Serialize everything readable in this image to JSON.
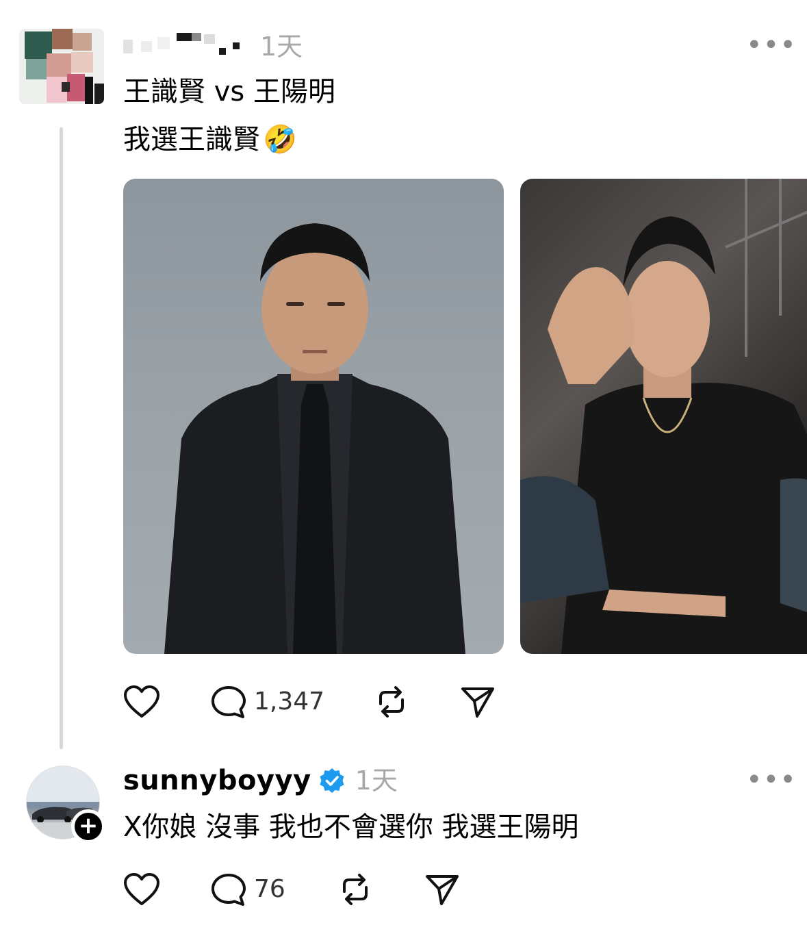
{
  "post": {
    "time": "1天",
    "more_label": "•••",
    "lines": [
      "王識賢 vs 王陽明",
      "我選王識賢"
    ],
    "emoji": "🤣",
    "stats": {
      "replies": "1,347"
    }
  },
  "reply": {
    "username": "sunnyboyyy",
    "verified": true,
    "time": "1天",
    "more_label": "•••",
    "text": "X你娘 沒事 我也不會選你 我選王陽明",
    "stats": {
      "replies": "76"
    }
  },
  "icons": {
    "like": "heart-icon",
    "reply": "comment-icon",
    "repost": "repost-icon",
    "share": "send-icon",
    "verified": "verified-badge-icon",
    "follow": "plus-icon"
  },
  "colors": {
    "verified": "#1d9bf0",
    "muted_text": "#a8a8a8",
    "thread_line": "#d6d6d6"
  }
}
